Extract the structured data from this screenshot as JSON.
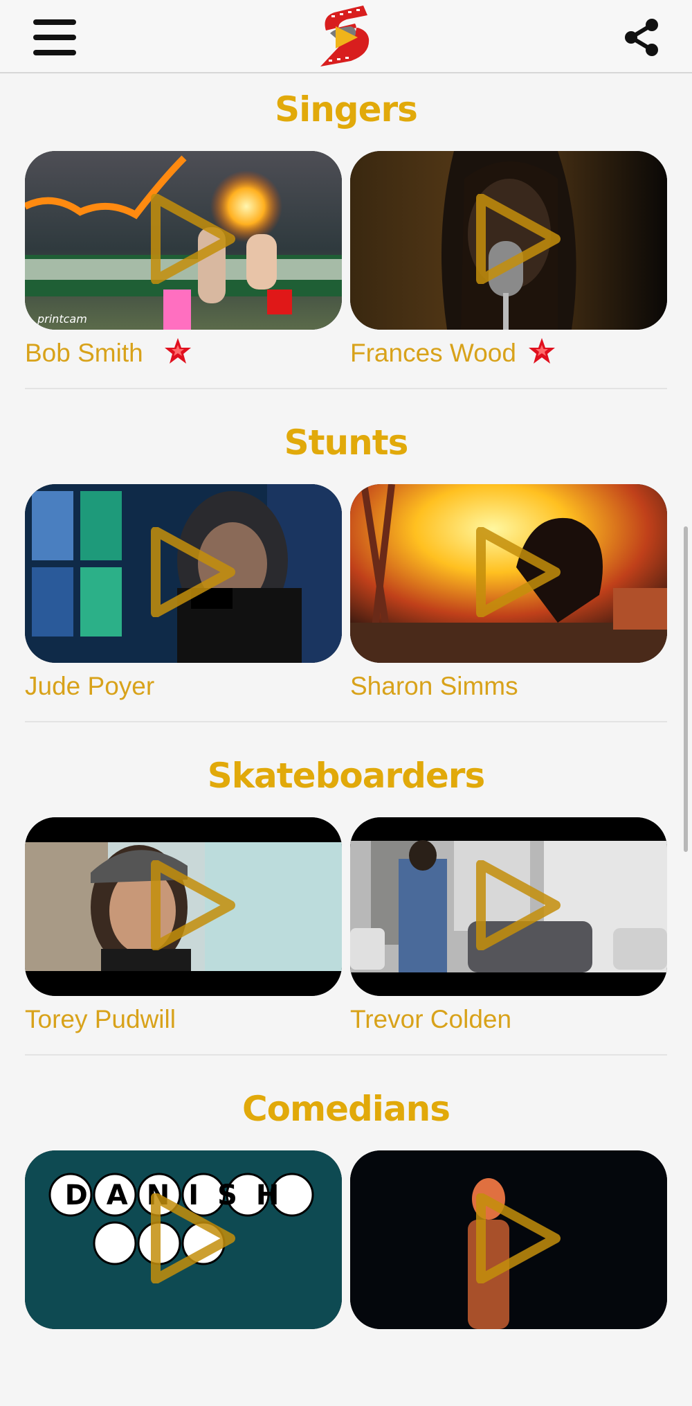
{
  "header": {
    "menu_icon": "hamburger-menu-icon",
    "logo_icon": "film-reel-s-logo-icon",
    "share_icon": "share-icon"
  },
  "colors": {
    "accent": "#e1a90a",
    "name_text": "#d8a21a",
    "star": "#e0101e",
    "background": "#f5f5f5"
  },
  "sections": [
    {
      "title": "Singers",
      "items": [
        {
          "name": "Bob Smith",
          "featured": true
        },
        {
          "name": "Frances Wood",
          "featured": true
        }
      ]
    },
    {
      "title": "Stunts",
      "items": [
        {
          "name": "Jude Poyer",
          "featured": false
        },
        {
          "name": "Sharon Simms",
          "featured": false
        }
      ]
    },
    {
      "title": "Skateboarders",
      "items": [
        {
          "name": "Torey Pudwill",
          "featured": false
        },
        {
          "name": "Trevor Colden",
          "featured": false
        }
      ]
    },
    {
      "title": "Comedians",
      "items": [
        {
          "name": "",
          "thumb_text": "DANISH",
          "featured": false
        },
        {
          "name": "",
          "featured": false
        }
      ]
    }
  ]
}
